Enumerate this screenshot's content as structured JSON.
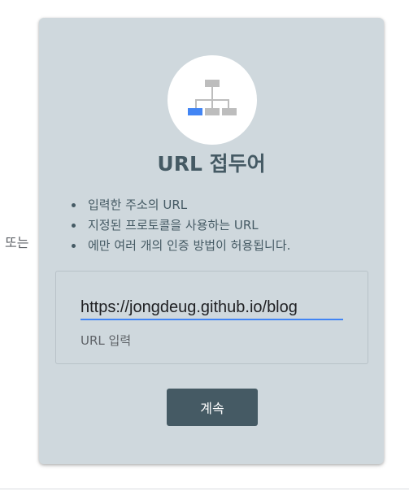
{
  "or_label": "또는",
  "card": {
    "icon": "sitemap-icon",
    "title": "URL 접두어",
    "bullets": [
      "입력한 주소의 URL",
      "지정된 프로토콜을 사용하는 URL",
      "에만 여러 개의 인증 방법이 허용됩니다."
    ],
    "input": {
      "value": "https://jongdeug.github.io/blog",
      "label": "URL 입력"
    },
    "continue_label": "계속"
  },
  "colors": {
    "card_bg": "#cfd8dd",
    "primary": "#455a64",
    "accent": "#4285f4"
  }
}
